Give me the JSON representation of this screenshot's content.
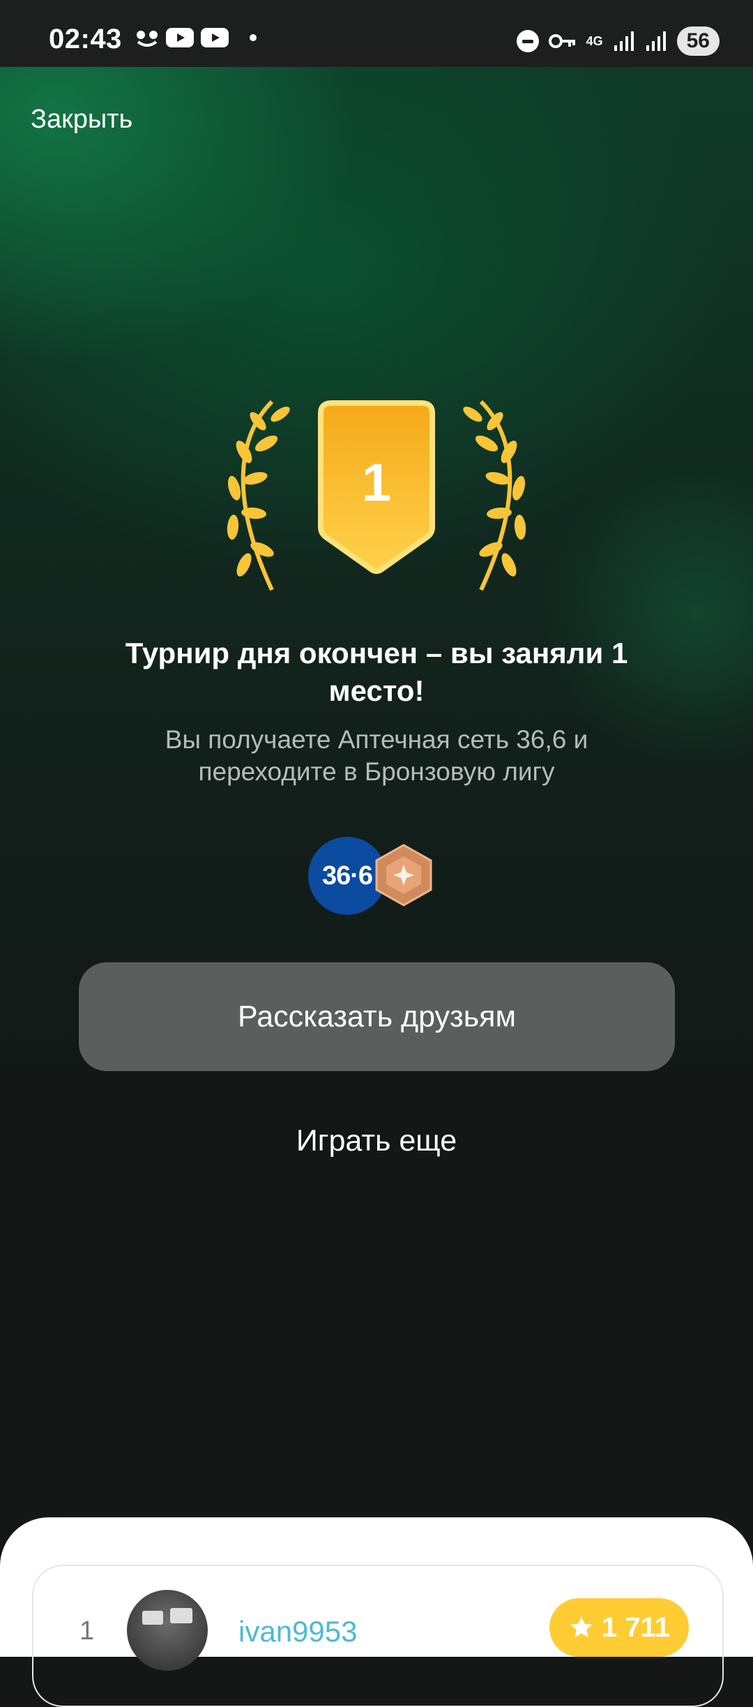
{
  "status_bar": {
    "time": "02:43",
    "network": "4G",
    "battery": "56"
  },
  "header": {
    "close_label": "Закрыть"
  },
  "result": {
    "place": "1",
    "title": "Турнир дня окончен – вы заняли 1 место!",
    "subtitle": "Вы получаете Аптечная сеть 36,6 и переходите в Бронзовую лигу"
  },
  "rewards": {
    "pharmacy_logo_text": "36·6",
    "colors": {
      "pharmacy": "#0b4ba0",
      "bronze": "#d08a5c",
      "gold": "#f5b21a"
    }
  },
  "actions": {
    "share_label": "Рассказать друзьям",
    "play_again_label": "Играть еще"
  },
  "leaderboard": {
    "rows": [
      {
        "rank": "1",
        "username": "ivan9953",
        "score": "1 711"
      }
    ]
  },
  "icons": [
    "close-link",
    "laurel-icon",
    "place-shield-icon",
    "bronze-league-icon",
    "star-icon"
  ]
}
